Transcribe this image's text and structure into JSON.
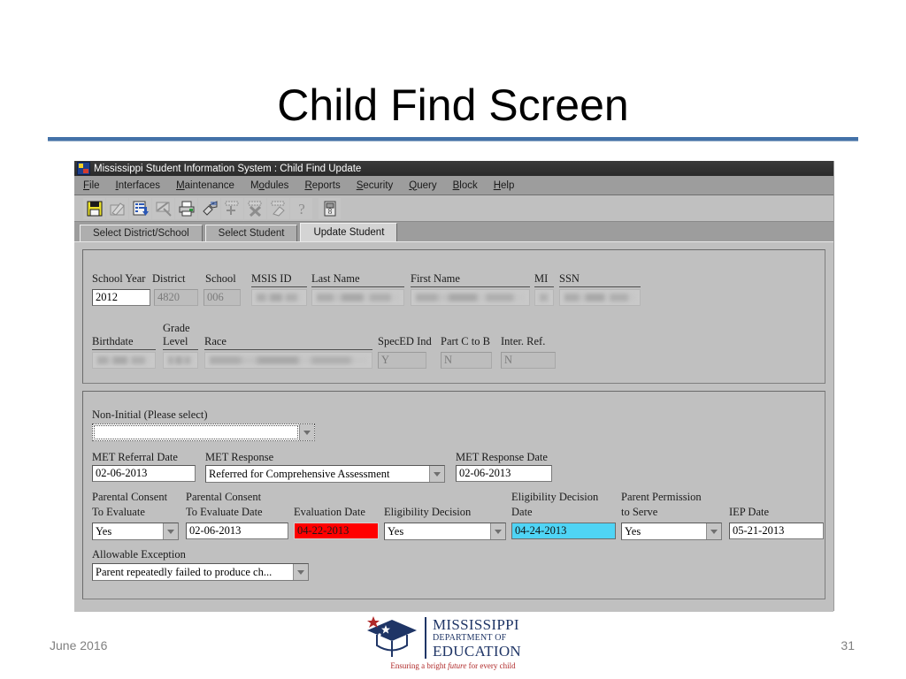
{
  "slide": {
    "title": "Child Find Screen",
    "footer_date": "June 2016",
    "page_number": "31"
  },
  "window": {
    "title": "Mississippi Student Information System : Child Find Update",
    "icon": "app-icon"
  },
  "menu": [
    {
      "pre": "",
      "mn": "F",
      "post": "ile"
    },
    {
      "pre": "",
      "mn": "I",
      "post": "nterfaces"
    },
    {
      "pre": "",
      "mn": "M",
      "post": "aintenance"
    },
    {
      "pre": "M",
      "mn": "o",
      "post": "dules"
    },
    {
      "pre": "",
      "mn": "R",
      "post": "eports"
    },
    {
      "pre": "",
      "mn": "S",
      "post": "ecurity"
    },
    {
      "pre": "",
      "mn": "Q",
      "post": "uery"
    },
    {
      "pre": "",
      "mn": "B",
      "post": "lock"
    },
    {
      "pre": "",
      "mn": "H",
      "post": "elp"
    }
  ],
  "toolbar": [
    {
      "name": "save-icon",
      "glyph": "save",
      "enabled": true
    },
    {
      "name": "edit-icon",
      "glyph": "edit",
      "enabled": false
    },
    {
      "name": "list-values-icon",
      "glyph": "list",
      "enabled": true
    },
    {
      "name": "cancel-query-icon",
      "glyph": "cancelquery",
      "enabled": false
    },
    {
      "name": "print-icon",
      "glyph": "print",
      "enabled": true
    },
    {
      "name": "execute-query-icon",
      "glyph": "flashlight",
      "enabled": true
    },
    {
      "name": "insert-record-icon",
      "glyph": "insert",
      "enabled": false
    },
    {
      "name": "delete-record-icon",
      "glyph": "delete",
      "enabled": false
    },
    {
      "name": "clear-record-icon",
      "glyph": "eraser",
      "enabled": false
    },
    {
      "name": "help-icon",
      "glyph": "question",
      "enabled": false
    },
    {
      "name": "exit-icon",
      "glyph": "exit",
      "enabled": true
    }
  ],
  "tabs": [
    {
      "label": "Select District/School",
      "active": false
    },
    {
      "label": "Select Student",
      "active": false
    },
    {
      "label": "Update Student",
      "active": true
    }
  ],
  "student_panel": {
    "fields": [
      {
        "label": "School Year",
        "value": "2012",
        "state": "editable"
      },
      {
        "label": "District",
        "value": "4820",
        "state": "disabled"
      },
      {
        "label": "School",
        "value": "006",
        "state": "disabled"
      },
      {
        "label": "MSIS ID",
        "value": "",
        "state": "blurred"
      },
      {
        "label": "Last Name",
        "value": "",
        "state": "blurred"
      },
      {
        "label": "First Name",
        "value": "",
        "state": "blurred"
      },
      {
        "label": "MI",
        "value": "",
        "state": "blurred"
      },
      {
        "label": "SSN",
        "value": "",
        "state": "blurred"
      },
      {
        "label": "Birthdate",
        "value": "",
        "state": "blurred"
      },
      {
        "label_line1": "Grade",
        "label_line2": "Level",
        "value": "",
        "state": "blurred"
      },
      {
        "label": "Race",
        "value": "",
        "state": "blurred"
      },
      {
        "label": "SpecED Ind",
        "value": "Y",
        "state": "disabled"
      },
      {
        "label": "Part C to B",
        "value": "N",
        "state": "disabled"
      },
      {
        "label": "Inter. Ref.",
        "value": "N",
        "state": "disabled"
      }
    ]
  },
  "childfind_panel": {
    "non_initial_label": "Non-Initial (Please select)",
    "non_initial_value": "",
    "met_referral_date_label": "MET Referral Date",
    "met_referral_date_value": "02-06-2013",
    "met_response_label": "MET Response",
    "met_response_value": "Referred for Comprehensive Assessment",
    "met_response_date_label": "MET Response Date",
    "met_response_date_value": "02-06-2013",
    "parental_consent_evaluate_label_1": "Parental Consent",
    "parental_consent_evaluate_label_2": "To Evaluate",
    "parental_consent_evaluate_value": "Yes",
    "parental_consent_date_label_1": "Parental Consent",
    "parental_consent_date_label_2": "To Evaluate Date",
    "parental_consent_date_value": "02-06-2013",
    "evaluation_date_label": "Evaluation Date",
    "evaluation_date_value": "04-22-2013",
    "eligibility_decision_label": "Eligibility Decision",
    "eligibility_decision_value": "Yes",
    "eligibility_decision_date_label_1": "Eligibility Decision",
    "eligibility_decision_date_label_2": "Date",
    "eligibility_decision_date_value": "04-24-2013",
    "parent_permission_label_1": "Parent Permission",
    "parent_permission_label_2": "to Serve",
    "parent_permission_value": "Yes",
    "iep_date_label": "IEP Date",
    "iep_date_value": "05-21-2013",
    "allowable_exception_label": "Allowable Exception",
    "allowable_exception_value": "Parent repeatedly failed to produce ch..."
  },
  "logo": {
    "line1": "MISSISSIPPI",
    "line2": "DEPARTMENT OF",
    "line3": "EDUCATION",
    "tagline_pre": "Ensuring a bright ",
    "tagline_em": "future",
    "tagline_post": " for every child"
  },
  "colors": {
    "accent_rule": "#4472a8",
    "highlight_red": "#ff0000",
    "highlight_cyan": "#4fd4f5",
    "window_face": "#c0c0c0",
    "titlebar": "#2b2b2b",
    "logo_blue": "#1f3566",
    "logo_red": "#b02a2a"
  }
}
